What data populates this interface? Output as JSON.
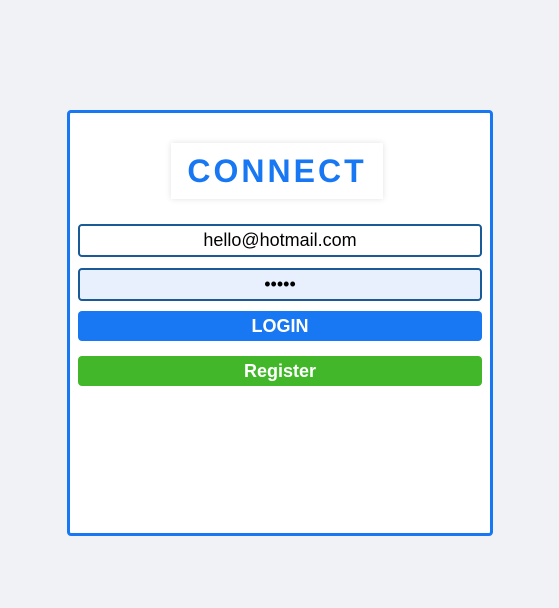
{
  "app": {
    "title": "CONNECT"
  },
  "form": {
    "email_value": "hello@hotmail.com",
    "password_value": "•••••",
    "login_label": "LOGIN",
    "register_label": "Register"
  },
  "colors": {
    "brand": "#1877f2",
    "register": "#42b72a",
    "password_field_bg": "#e8f0fe",
    "page_bg": "#f0f2f5"
  }
}
